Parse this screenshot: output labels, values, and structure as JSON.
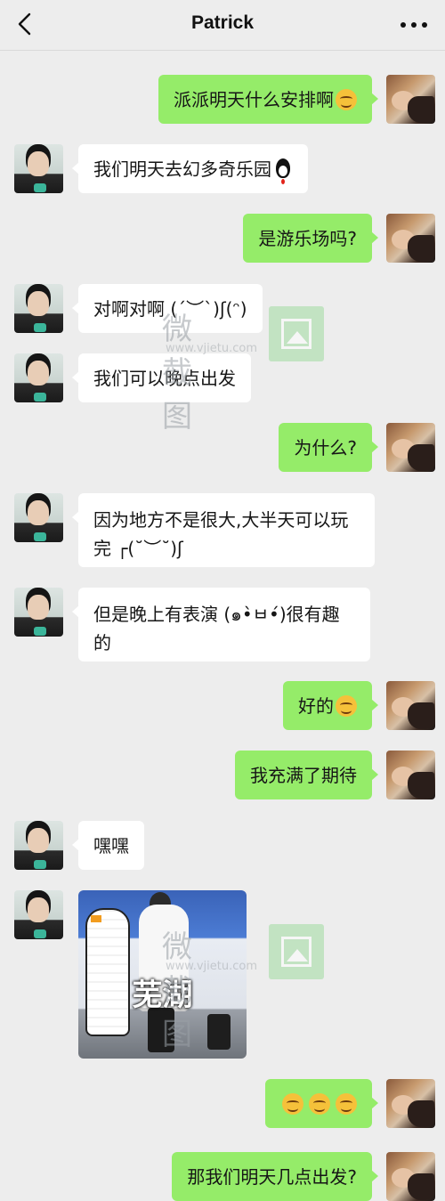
{
  "header": {
    "title": "Patrick",
    "back_icon": "chevron-left-icon",
    "more_icon": "more-dots-icon"
  },
  "messages": [
    {
      "from": "me",
      "text": "派派明天什么安排啊",
      "emoji": "blush-emoji-icon"
    },
    {
      "from": "friend",
      "text": "我们明天去幻多奇乐园",
      "emoji": "qq-penguin-icon"
    },
    {
      "from": "me",
      "text": "是游乐场吗?"
    },
    {
      "from": "friend",
      "text": "对啊对啊 (ˊ︶ˋ)ʃ(ᵔ)"
    },
    {
      "from": "friend",
      "text": "我们可以晚点出发"
    },
    {
      "from": "me",
      "text": "为什么?"
    },
    {
      "from": "friend",
      "text": "因为地方不是很大,大半天可以玩完 ┌(˘︶˘)ʃ"
    },
    {
      "from": "friend",
      "text": "但是晚上有表演 (๑•̀ㅂ•́)很有趣的"
    },
    {
      "from": "me",
      "text": "好的",
      "emoji": "grin-emoji-icon"
    },
    {
      "from": "me",
      "text": "我充满了期待"
    },
    {
      "from": "friend",
      "text": "嘿嘿"
    },
    {
      "from": "friend",
      "sticker_caption": "芜湖"
    },
    {
      "from": "me",
      "text": "",
      "emoji": "tears-of-joy-emoji-icon"
    },
    {
      "from": "me",
      "text": "那我们明天几点出发?"
    }
  ],
  "watermark": {
    "text": "微截图",
    "url": "www.vjietu.com"
  },
  "colors": {
    "me_bubble": "#95ec69",
    "friend_bubble": "#ffffff",
    "background": "#ededed"
  }
}
